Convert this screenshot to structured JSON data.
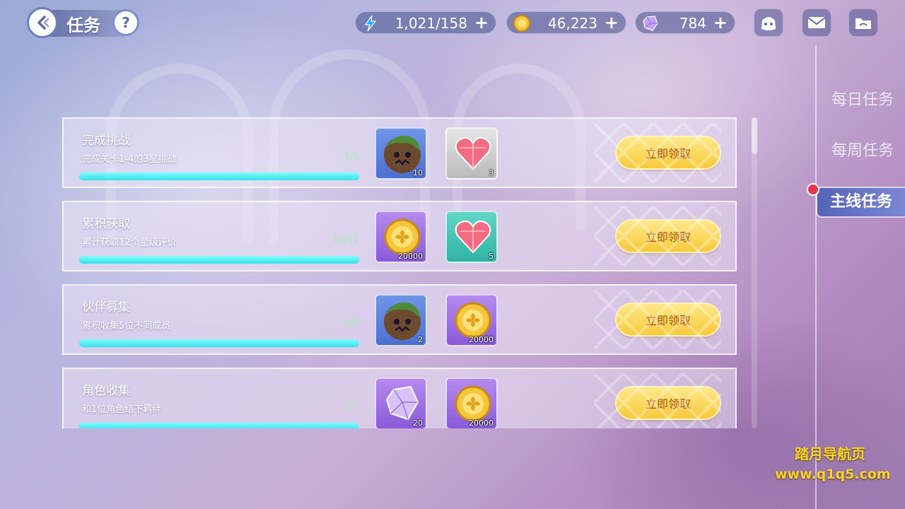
{
  "header": {
    "title": "任务",
    "help_label": "?",
    "resources": [
      {
        "name": "stamina",
        "value": "1,021/158",
        "icon": "lightning-icon",
        "color": "#2aa8ff"
      },
      {
        "name": "gold",
        "value": "46,223",
        "icon": "gold-coin-icon",
        "color": "#f5c53a"
      },
      {
        "name": "crystal",
        "value": "784",
        "icon": "crystal-icon",
        "color": "#b48cf2"
      }
    ],
    "plus_label": "+",
    "icons": [
      "bag-icon",
      "mail-icon",
      "folder-icon"
    ]
  },
  "tasks": [
    {
      "title": "完成挑战",
      "desc": "完成关卡1-4的3星挑战",
      "progress_text": "1/1",
      "progress": 1.0,
      "rewards": [
        {
          "type": "tree-monster-icon",
          "bg": "blue",
          "count": "10"
        },
        {
          "type": "heart-gem-icon",
          "bg": "grey",
          "count": "3"
        }
      ],
      "button": "立即领取"
    },
    {
      "title": "累积获取",
      "desc": "累计获取12个星级评价",
      "progress_text": "12/12",
      "progress": 1.0,
      "rewards": [
        {
          "type": "gold-coin-icon",
          "bg": "purple",
          "count": "20000"
        },
        {
          "type": "heart-gem-icon",
          "bg": "teal",
          "count": "5"
        }
      ],
      "button": "立即领取"
    },
    {
      "title": "伙伴募集",
      "desc": "累积收集5位不同成员",
      "progress_text": "5/5",
      "progress": 1.0,
      "rewards": [
        {
          "type": "tree-monster-icon",
          "bg": "blue",
          "count": "2"
        },
        {
          "type": "gold-coin-icon",
          "bg": "purple",
          "count": "20000"
        }
      ],
      "button": "立即领取"
    },
    {
      "title": "角色收集",
      "desc": "和1位角色结下羁绊",
      "progress_text": "1/1",
      "progress": 1.0,
      "rewards": [
        {
          "type": "crystal-icon",
          "bg": "purple",
          "count": "20"
        },
        {
          "type": "gold-coin-icon",
          "bg": "purple",
          "count": "20000"
        }
      ],
      "button": "立即领取"
    }
  ],
  "tabs": [
    {
      "label": "每日任务",
      "active": false
    },
    {
      "label": "每周任务",
      "active": false
    },
    {
      "label": "主线任务",
      "active": true
    }
  ],
  "watermark": {
    "line1": "踏月导航页",
    "line2": "www.q1q5.com"
  }
}
